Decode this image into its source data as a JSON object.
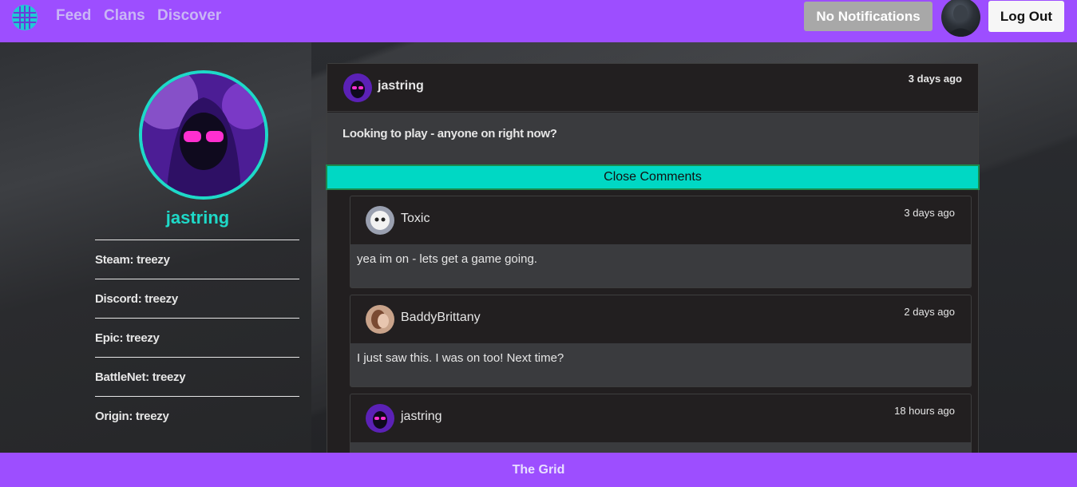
{
  "nav": {
    "links": [
      "Feed",
      "Clans",
      "Discover"
    ],
    "notifications_label": "No Notifications",
    "logout_label": "Log Out"
  },
  "profile": {
    "username": "jastring",
    "accounts": [
      "Steam: treezy",
      "Discord: treezy",
      "Epic: treezy",
      "BattleNet: treezy",
      "Origin: treezy"
    ]
  },
  "post": {
    "author": "jastring",
    "time": "3 days ago",
    "text": "Looking to play - anyone on right now?",
    "close_comments_label": "Close Comments"
  },
  "comments": [
    {
      "author": "Toxic",
      "time": "3 days ago",
      "text": "yea im on - lets get a game going."
    },
    {
      "author": "BaddyBrittany",
      "time": "2 days ago",
      "text": "I just saw this. I was on too! Next time?"
    },
    {
      "author": "jastring",
      "time": "18 hours ago",
      "text": ""
    }
  ],
  "footer": {
    "label": "The Grid"
  },
  "colors": {
    "brand_purple": "#9d4eff",
    "accent_teal": "#1ed9c8",
    "close_comments_bg": "#00d8c4"
  }
}
